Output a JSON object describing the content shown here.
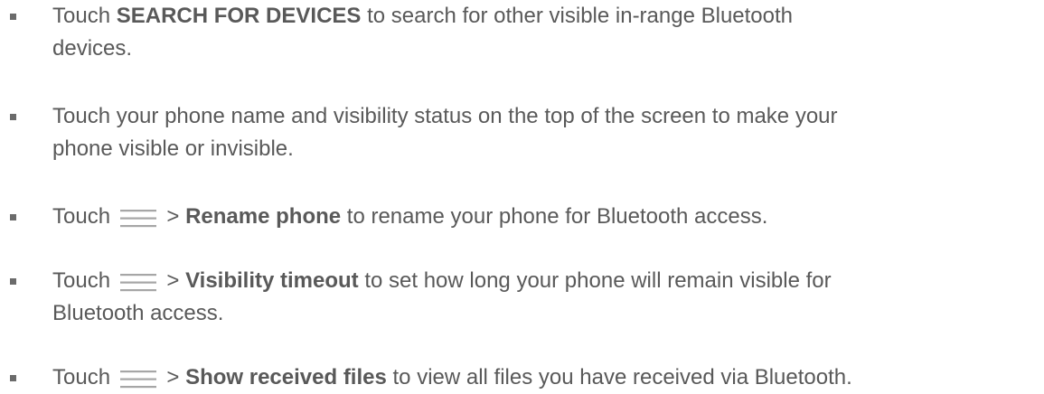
{
  "items": [
    {
      "lines": [
        {
          "pre": "Touch ",
          "bold": "SEARCH FOR DEVICES",
          "post": " to search for other visible in-range Bluetooth"
        },
        {
          "text": "devices."
        }
      ]
    },
    {
      "lines": [
        {
          "text": "Touch your phone name and visibility status on the top of the screen to make your"
        },
        {
          "text": "phone visible or invisible."
        }
      ]
    },
    {
      "pre": "Touch ",
      "icon": "menu-icon",
      "sep": " > ",
      "bold": "Rename phone",
      "post": " to rename your phone for Bluetooth access."
    },
    {
      "pre": "Touch ",
      "icon": "menu-icon",
      "sep": " > ",
      "bold": "Visibility timeout",
      "post": " to set how long your phone will remain visible for",
      "line2": "Bluetooth access."
    },
    {
      "pre": "Touch ",
      "icon": "menu-icon",
      "sep": " > ",
      "bold": "Show received files",
      "post": " to view all files you have received via Bluetooth."
    }
  ],
  "colors": {
    "text": "#595959",
    "bullet": "#6b6b6b",
    "icon": "#a6a6a6"
  }
}
